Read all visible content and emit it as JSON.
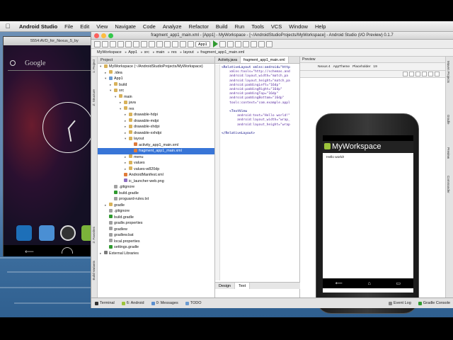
{
  "menubar": {
    "items": [
      "Android Studio",
      "File",
      "Edit",
      "View",
      "Navigate",
      "Code",
      "Analyze",
      "Refactor",
      "Build",
      "Run",
      "Tools",
      "VCS",
      "Window",
      "Help"
    ]
  },
  "emulator": {
    "title": "5554:AVD_for_Nexus_5_by",
    "search_label": "Google"
  },
  "ide": {
    "title": "fragment_app1_main.xml - [App1] - MyWorkspace - [~/AndroidStudioProjects/MyWorkspace] - Android Studio (I/O Preview) 0.1.7",
    "toolbar": {
      "module_selector": "App1"
    },
    "breadcrumb": [
      "MyWorkspace",
      "App1",
      "src",
      "main",
      "res",
      "layout",
      "fragment_app1_main.xml"
    ],
    "left_strip": [
      "1: Project",
      "Z: Structure",
      "2: Favorites",
      "Build Variants"
    ],
    "right_strip": [
      "Maven Projects",
      "Gradle",
      "Preview",
      "Commander"
    ]
  },
  "project_panel": {
    "header": "Project",
    "tree": [
      {
        "label": "MyWorkspace (~/AndroidStudioProjects/MyWorkspace)",
        "depth": 0,
        "arrow": "▾",
        "kind": "folder"
      },
      {
        "label": ".idea",
        "depth": 1,
        "arrow": "▸",
        "kind": "folder"
      },
      {
        "label": "App1",
        "depth": 1,
        "arrow": "▾",
        "kind": "module"
      },
      {
        "label": "build",
        "depth": 2,
        "arrow": "▸",
        "kind": "folder"
      },
      {
        "label": "src",
        "depth": 2,
        "arrow": "▾",
        "kind": "folder"
      },
      {
        "label": "main",
        "depth": 3,
        "arrow": "▾",
        "kind": "folder"
      },
      {
        "label": "java",
        "depth": 4,
        "arrow": "▸",
        "kind": "folder"
      },
      {
        "label": "res",
        "depth": 4,
        "arrow": "▾",
        "kind": "folder"
      },
      {
        "label": "drawable-hdpi",
        "depth": 5,
        "arrow": "▸",
        "kind": "folder"
      },
      {
        "label": "drawable-mdpi",
        "depth": 5,
        "arrow": "▸",
        "kind": "folder"
      },
      {
        "label": "drawable-xhdpi",
        "depth": 5,
        "arrow": "▸",
        "kind": "folder"
      },
      {
        "label": "drawable-xxhdpi",
        "depth": 5,
        "arrow": "▸",
        "kind": "folder"
      },
      {
        "label": "layout",
        "depth": 5,
        "arrow": "▾",
        "kind": "folder"
      },
      {
        "label": "activity_app1_main.xml",
        "depth": 6,
        "arrow": "",
        "kind": "xml"
      },
      {
        "label": "fragment_app1_main.xml",
        "depth": 6,
        "arrow": "",
        "kind": "xml",
        "selected": true
      },
      {
        "label": "menu",
        "depth": 5,
        "arrow": "▸",
        "kind": "folder"
      },
      {
        "label": "values",
        "depth": 5,
        "arrow": "▸",
        "kind": "folder"
      },
      {
        "label": "values-w820dp",
        "depth": 5,
        "arrow": "▸",
        "kind": "folder"
      },
      {
        "label": "AndroidManifest.xml",
        "depth": 4,
        "arrow": "",
        "kind": "xml"
      },
      {
        "label": "ic_launcher-web.png",
        "depth": 4,
        "arrow": "",
        "kind": "image"
      },
      {
        "label": ".gitignore",
        "depth": 2,
        "arrow": "",
        "kind": "file"
      },
      {
        "label": "build.gradle",
        "depth": 2,
        "arrow": "",
        "kind": "gradle"
      },
      {
        "label": "proguard-rules.txt",
        "depth": 2,
        "arrow": "",
        "kind": "file"
      },
      {
        "label": "gradle",
        "depth": 1,
        "arrow": "▸",
        "kind": "folder"
      },
      {
        "label": ".gitignore",
        "depth": 1,
        "arrow": "",
        "kind": "file"
      },
      {
        "label": "build.gradle",
        "depth": 1,
        "arrow": "",
        "kind": "gradle"
      },
      {
        "label": "gradle.properties",
        "depth": 1,
        "arrow": "",
        "kind": "file"
      },
      {
        "label": "gradlew",
        "depth": 1,
        "arrow": "",
        "kind": "file"
      },
      {
        "label": "gradlew.bat",
        "depth": 1,
        "arrow": "",
        "kind": "file"
      },
      {
        "label": "local.properties",
        "depth": 1,
        "arrow": "",
        "kind": "file"
      },
      {
        "label": "settings.gradle",
        "depth": 1,
        "arrow": "",
        "kind": "gradle"
      },
      {
        "label": "External Libraries",
        "depth": 0,
        "arrow": "▸",
        "kind": "library"
      }
    ]
  },
  "editor": {
    "tabs": [
      {
        "label": "Activity.java",
        "active": false
      },
      {
        "label": "fragment_app1_main.xml",
        "active": true
      }
    ],
    "code_lines": [
      "<RelativeLayout xmlns:android=\"http",
      "    xmlns:tools=\"http://schemas.and",
      "    android:layout_width=\"match_pa",
      "    android:layout_height=\"match_pa",
      "    android:paddingLeft=\"16dp\"",
      "    android:paddingRight=\"16dp\"",
      "    android:paddingTop=\"16dp\"",
      "    android:paddingBottom=\"16dp\"",
      "    tools:context=\"com.example.appl",
      "",
      "    <TextView",
      "        android:text=\"Hello world!\"",
      "        android:layout_width=\"wrap_",
      "        android:layout_height=\"wrap",
      "",
      "</RelativeLayout>"
    ],
    "bottom_tabs": [
      {
        "label": "Design",
        "active": false
      },
      {
        "label": "Text",
        "active": true
      }
    ]
  },
  "preview": {
    "header": "Preview",
    "toolbar": [
      "Nexus 4",
      "AppTheme",
      "Placeholder",
      "19"
    ],
    "app_title": "MyWorkspace",
    "hello_text": "Hello world!"
  },
  "statusbar": {
    "items": [
      "Terminal",
      "6: Android",
      "0: Messages",
      "TODO",
      "Event Log",
      "Gradle Console"
    ]
  },
  "colors": {
    "selection": "#3875d7",
    "run_green": "#2f9a2f",
    "android_green": "#9cc33b"
  }
}
